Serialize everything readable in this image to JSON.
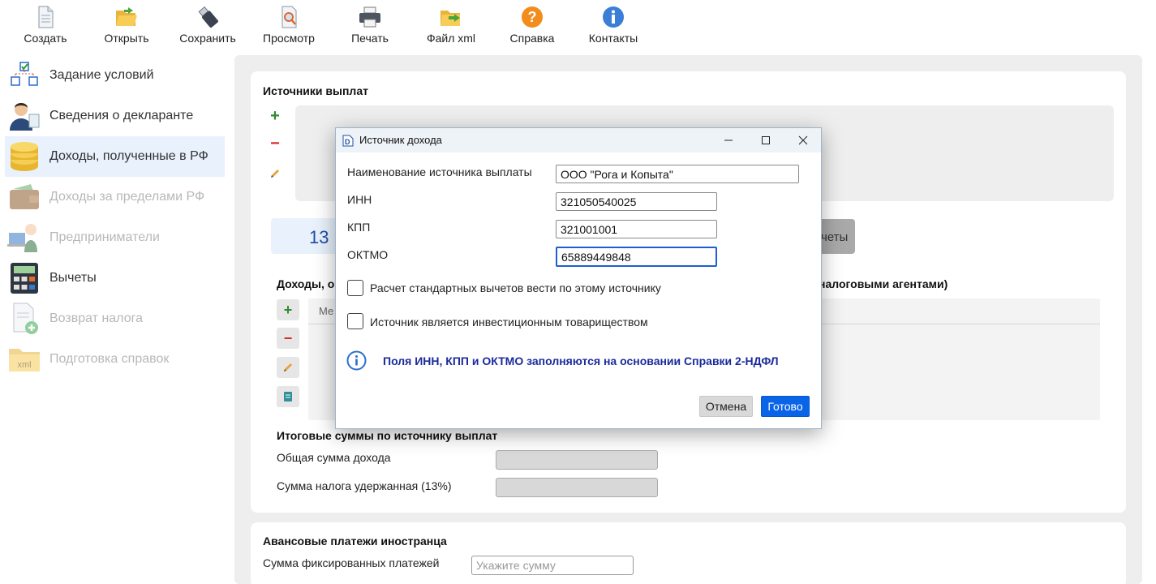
{
  "toolbar": {
    "create": "Создать",
    "open": "Открыть",
    "save": "Сохранить",
    "preview": "Просмотр",
    "print": "Печать",
    "xml": "Файл xml",
    "help": "Справка",
    "contacts": "Контакты"
  },
  "sidebar": {
    "items": [
      {
        "label": "Задание условий",
        "icon": "conditions-icon",
        "state": "normal"
      },
      {
        "label": "Сведения о декларанте",
        "icon": "declarant-icon",
        "state": "normal"
      },
      {
        "label": "Доходы, полученные в РФ",
        "icon": "coins-icon",
        "state": "active"
      },
      {
        "label": "Доходы за пределами РФ",
        "icon": "wallet-icon",
        "state": "disabled"
      },
      {
        "label": "Предприниматели",
        "icon": "entrepreneur-icon",
        "state": "disabled"
      },
      {
        "label": "Вычеты",
        "icon": "calculator-icon",
        "state": "normal"
      },
      {
        "label": "Возврат налога",
        "icon": "refund-doc-icon",
        "state": "disabled"
      },
      {
        "label": "Подготовка справок",
        "icon": "xml-folder-icon",
        "state": "disabled"
      }
    ]
  },
  "main": {
    "sources_title": "Источники выплат",
    "rate_tab": "13",
    "deductions_tab_partial": "четы",
    "income_title_left": "Доходы, о",
    "income_title_right": "налоговыми агентами)",
    "month_col_partial": "Ме",
    "totals_title": "Итоговые суммы по источнику выплат",
    "total_income_label": "Общая сумма дохода",
    "total_tax_label": "Сумма налога удержанная (13%)",
    "advance_title": "Авансовые платежи иностранца",
    "fixed_payments_label": "Сумма фиксированных платежей",
    "fixed_payments_placeholder": "Укажите сумму"
  },
  "dialog": {
    "title": "Источник дохода",
    "name_label": "Наименование источника выплаты",
    "name_value": "ООО \"Рога и Копыта\"",
    "inn_label": "ИНН",
    "inn_value": "321050540025",
    "kpp_label": "КПП",
    "kpp_value": "321001001",
    "oktmo_label": "ОКТМО",
    "oktmo_value": "65889449848",
    "std_deductions_label": "Расчет стандартных вычетов вести по этому источнику",
    "std_deductions_checked": false,
    "investment_label": "Источник является инвестиционным товариществом",
    "investment_checked": false,
    "info_text": "Поля ИНН, КПП и ОКТМО заполняются на основании Справки 2-НДФЛ",
    "cancel": "Отмена",
    "ok": "Готово"
  },
  "colors": {
    "accent": "#0a64e8",
    "active_sidebar": "#e8f1fc",
    "info_text": "#1b2a9c",
    "add_green": "#2e8b2e",
    "remove_red": "#d42b2b"
  }
}
